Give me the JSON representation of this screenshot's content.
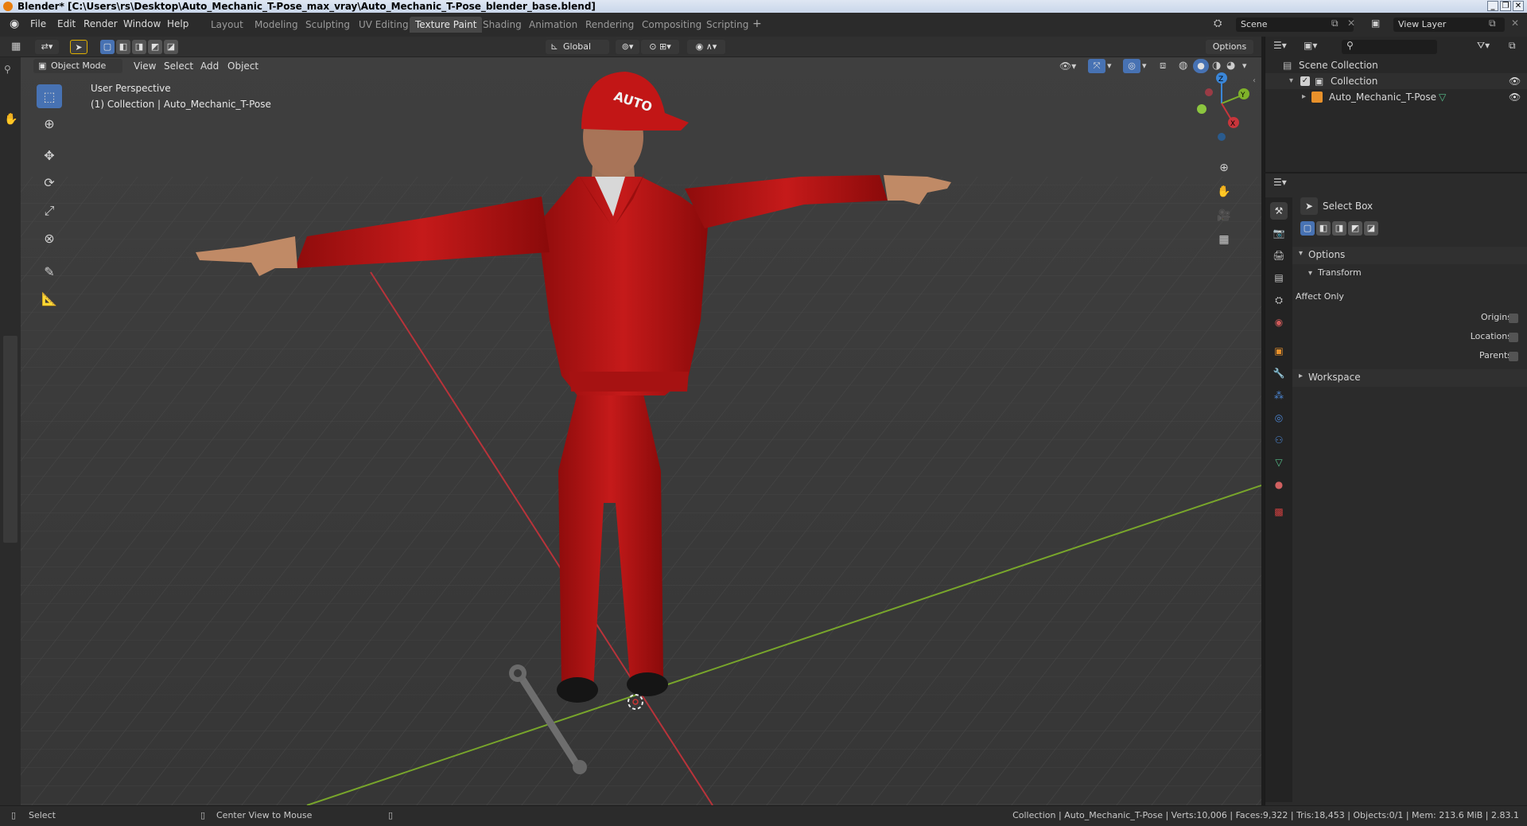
{
  "window": {
    "title": "Blender* [C:\\Users\\rs\\Desktop\\Auto_Mechanic_T-Pose_max_vray\\Auto_Mechanic_T-Pose_blender_base.blend]"
  },
  "menu": [
    "File",
    "Edit",
    "Render",
    "Window",
    "Help"
  ],
  "workspace_tabs": [
    "Layout",
    "Modeling",
    "Sculpting",
    "UV Editing",
    "Texture Paint",
    "Shading",
    "Animation",
    "Rendering",
    "Compositing",
    "Scripting"
  ],
  "active_workspace": "Texture Paint",
  "scene": {
    "name": "Scene"
  },
  "view_layer": {
    "name": "View Layer"
  },
  "viewport_header": {
    "mode": "Object Mode",
    "menus": [
      "View",
      "Select",
      "Add",
      "Object"
    ],
    "orientation": "Global",
    "options_label": "Options"
  },
  "viewport": {
    "perspective_label": "User Perspective",
    "collection_label": "(1) Collection | Auto_Mechanic_T-Pose",
    "cap_text": "AUTO"
  },
  "outliner": {
    "scene_collection": "Scene Collection",
    "collection": "Collection",
    "object": "Auto_Mechanic_T-Pose"
  },
  "properties": {
    "tool_name": "Select Box",
    "options_header": "Options",
    "transform_header": "Transform",
    "affect_only": "Affect Only",
    "origins": "Origins",
    "locations": "Locations",
    "parents": "Parents",
    "workspace_header": "Workspace"
  },
  "statusbar": {
    "select": "Select",
    "center_view": "Center View to Mouse",
    "stats": "Collection | Auto_Mechanic_T-Pose | Verts:10,006 | Faces:9,322 | Tris:18,453 | Objects:0/1 | Mem: 213.6 MiB | 2.83.1"
  },
  "colors": {
    "accent": "#4772b3",
    "axis_x": "#c8353b",
    "axis_y": "#7fb22a",
    "axis_z": "#3a86d8",
    "suit_red": "#b31313"
  },
  "icons": [
    "blender-logo-icon",
    "search-icon",
    "filter-icon",
    "eye-icon",
    "select-box-icon",
    "cursor-icon",
    "move-icon",
    "rotate-icon",
    "scale-icon",
    "transform-icon",
    "annotate-icon",
    "measure-icon",
    "zoom-icon",
    "hand-icon",
    "camera-icon",
    "grid-icon",
    "wrench-icon"
  ]
}
